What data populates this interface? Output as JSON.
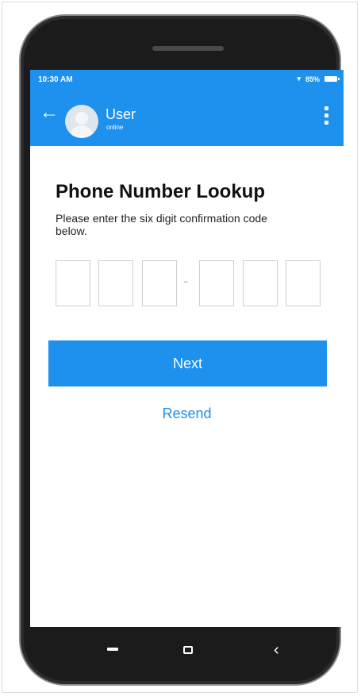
{
  "status_bar": {
    "time": "10:30 AM",
    "battery": "85%"
  },
  "app_bar": {
    "back_icon": "←",
    "user_name": "User",
    "user_status": "online",
    "menu_icon": "more-vert-icon"
  },
  "main": {
    "title": "Phone Number Lookup",
    "description": "Please enter the six digit confirmation code below.",
    "code_values": [
      "",
      "",
      "",
      "",
      "",
      ""
    ],
    "separator": "-",
    "next_label": "Next",
    "resend_label": "Resend"
  },
  "nav": {
    "back_icon": "‹"
  },
  "colors": {
    "accent": "#1e90ee"
  }
}
